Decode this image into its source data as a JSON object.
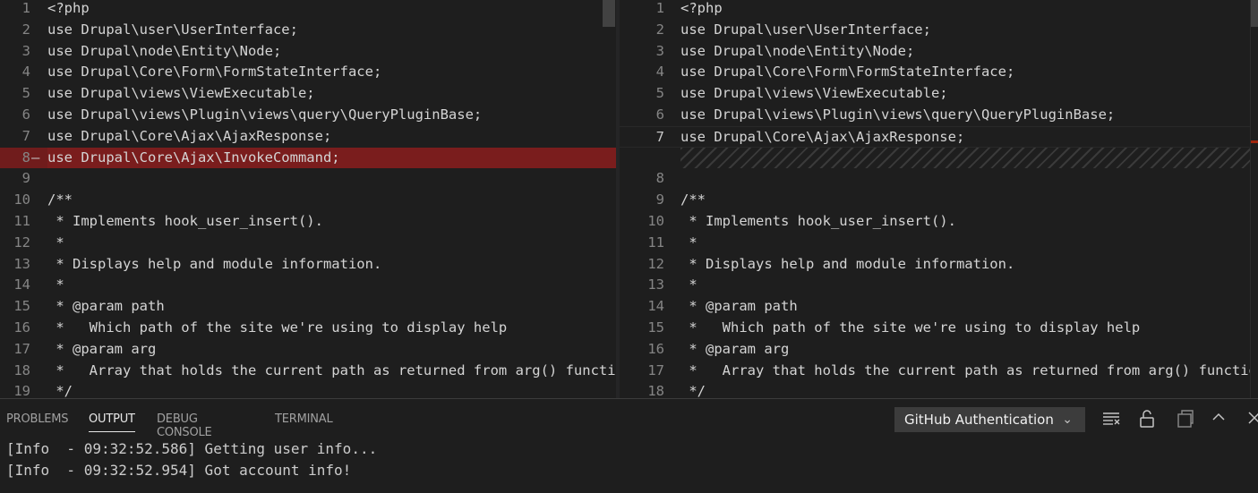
{
  "diff": {
    "left": {
      "lines": [
        {
          "num": "1",
          "text": "<?php"
        },
        {
          "num": "2",
          "text": "use Drupal\\user\\UserInterface;"
        },
        {
          "num": "3",
          "text": "use Drupal\\node\\Entity\\Node;"
        },
        {
          "num": "4",
          "text": "use Drupal\\Core\\Form\\FormStateInterface;"
        },
        {
          "num": "5",
          "text": "use Drupal\\views\\ViewExecutable;"
        },
        {
          "num": "6",
          "text": "use Drupal\\views\\Plugin\\views\\query\\QueryPluginBase;"
        },
        {
          "num": "7",
          "text": "use Drupal\\Core\\Ajax\\AjaxResponse;"
        },
        {
          "num": "8",
          "text": "use Drupal\\Core\\Ajax\\InvokeCommand;",
          "removed": true,
          "marker": "—"
        },
        {
          "num": "9",
          "text": ""
        },
        {
          "num": "10",
          "text": "/**"
        },
        {
          "num": "11",
          "text": " * Implements hook_user_insert()."
        },
        {
          "num": "12",
          "text": " *"
        },
        {
          "num": "13",
          "text": " * Displays help and module information."
        },
        {
          "num": "14",
          "text": " *"
        },
        {
          "num": "15",
          "text": " * @param path"
        },
        {
          "num": "16",
          "text": " *   Which path of the site we're using to display help"
        },
        {
          "num": "17",
          "text": " * @param arg"
        },
        {
          "num": "18",
          "text": " *   Array that holds the current path as returned from arg() function"
        },
        {
          "num": "19",
          "text": " */"
        }
      ]
    },
    "right": {
      "lines": [
        {
          "num": "1",
          "text": "<?php"
        },
        {
          "num": "2",
          "text": "use Drupal\\user\\UserInterface;"
        },
        {
          "num": "3",
          "text": "use Drupal\\node\\Entity\\Node;"
        },
        {
          "num": "4",
          "text": "use Drupal\\Core\\Form\\FormStateInterface;"
        },
        {
          "num": "5",
          "text": "use Drupal\\views\\ViewExecutable;"
        },
        {
          "num": "6",
          "text": "use Drupal\\views\\Plugin\\views\\query\\QueryPluginBase;"
        },
        {
          "num": "7",
          "text": "use Drupal\\Core\\Ajax\\AjaxResponse;",
          "current": true
        },
        {
          "num": "",
          "text": "",
          "placeholder": true
        },
        {
          "num": "8",
          "text": ""
        },
        {
          "num": "9",
          "text": "/**"
        },
        {
          "num": "10",
          "text": " * Implements hook_user_insert()."
        },
        {
          "num": "11",
          "text": " *"
        },
        {
          "num": "12",
          "text": " * Displays help and module information."
        },
        {
          "num": "13",
          "text": " *"
        },
        {
          "num": "14",
          "text": " * @param path"
        },
        {
          "num": "15",
          "text": " *   Which path of the site we're using to display help"
        },
        {
          "num": "16",
          "text": " * @param arg"
        },
        {
          "num": "17",
          "text": " *   Array that holds the current path as returned from arg() function"
        },
        {
          "num": "18",
          "text": " */"
        }
      ]
    }
  },
  "panel": {
    "tabs": {
      "problems": "PROBLEMS",
      "output": "OUTPUT",
      "debug": "DEBUG CONSOLE",
      "terminal": "TERMINAL"
    },
    "active_tab": "OUTPUT",
    "channel": "GitHub Authentication",
    "icons": [
      "clear-output-icon",
      "lock-scroll-icon",
      "open-log-icon",
      "maximize-panel-icon",
      "close-panel-icon"
    ],
    "output_lines": [
      "[Info  - 09:32:52.586] Getting user info...",
      "[Info  - 09:32:52.954] Got account info!"
    ]
  },
  "colors": {
    "editor_bg": "#1e1e1e",
    "removed_line_bg": "#7a1d1d",
    "line_number": "#858585",
    "text": "#d4d4d4"
  }
}
